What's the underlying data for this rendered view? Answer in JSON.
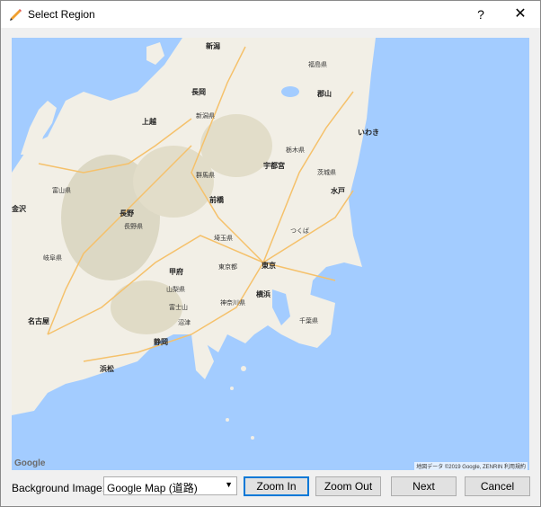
{
  "window": {
    "title": "Select Region",
    "help_label": "?",
    "close_label": "✕"
  },
  "map": {
    "logo": "Google",
    "attribution": "地図データ ©2019 Google, ZENRIN  利用規約",
    "labels": {
      "niigata": "新潟",
      "fukushima": "福島県",
      "nagaoka": "長岡",
      "niigata_pref": "新潟県",
      "joetsu": "上越",
      "koriyama": "郡山",
      "iwaki": "いわき",
      "toyama": "富山県",
      "kanazawa": "金沢",
      "tochigi": "栃木県",
      "utsunomiya": "宇都宮",
      "gunma": "群馬県",
      "maebashi": "前橋",
      "ibaraki": "茨城県",
      "mito": "水戸",
      "nagano": "長野",
      "nagano_pref": "長野県",
      "saitama": "埼玉県",
      "tsukuba": "つくば",
      "tokyo": "東京",
      "tokyo_pref": "東京都",
      "gifu": "岐阜県",
      "kofu": "甲府",
      "yamanashi": "山梨県",
      "yokohama": "横浜",
      "kanagawa": "神奈川県",
      "chiba": "千葉県",
      "nagoya": "名古屋",
      "shizuoka": "静岡",
      "hamamatsu": "浜松",
      "numazu": "沼津",
      "fuji": "富士山"
    }
  },
  "footer": {
    "background_label": "Background Image:",
    "background_value": "Google Map (道路)",
    "zoom_in": "Zoom In",
    "zoom_out": "Zoom Out",
    "next": "Next",
    "cancel": "Cancel"
  },
  "colors": {
    "sea": "#a3ccff",
    "land": "#f2efe6",
    "mountain": "#d9d6c6",
    "road": "#f5c16b",
    "accent": "#0078d7"
  }
}
